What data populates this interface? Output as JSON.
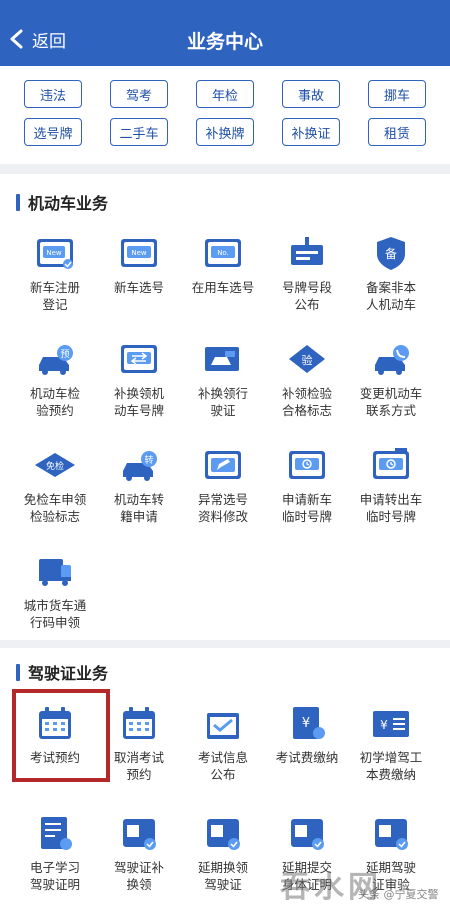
{
  "header": {
    "back_label": "返回",
    "title": "业务中心"
  },
  "chips": [
    "违法",
    "驾考",
    "年检",
    "事故",
    "挪车",
    "选号牌",
    "二手车",
    "补换牌",
    "补换证",
    "租赁"
  ],
  "section1": {
    "title": "机动车业务",
    "items": [
      {
        "label": "新车注册\n登记",
        "icon": "new-car-registration-icon"
      },
      {
        "label": "新车选号",
        "icon": "new-car-plate-icon"
      },
      {
        "label": "在用车选号",
        "icon": "in-use-plate-icon"
      },
      {
        "label": "号牌号段\n公布",
        "icon": "plate-range-sign-icon"
      },
      {
        "label": "备案非本\n人机动车",
        "icon": "filing-shield-icon"
      },
      {
        "label": "机动车检\n验预约",
        "icon": "car-inspection-icon"
      },
      {
        "label": "补换领机\n动车号牌",
        "icon": "plate-exchange-icon"
      },
      {
        "label": "补换领行\n驶证",
        "icon": "license-exchange-icon"
      },
      {
        "label": "补领检验\n合格标志",
        "icon": "inspection-badge-icon"
      },
      {
        "label": "变更机动车\n联系方式",
        "icon": "car-phone-icon"
      },
      {
        "label": "免检车申领\n检验标志",
        "icon": "exempt-badge-icon"
      },
      {
        "label": "机动车转\n籍申请",
        "icon": "car-transfer-icon"
      },
      {
        "label": "异常选号\n资料修改",
        "icon": "edit-card-icon"
      },
      {
        "label": "申请新车\n临时号牌",
        "icon": "temp-plate-clock-icon"
      },
      {
        "label": "申请转出车\n临时号牌",
        "icon": "temp-plate-out-icon"
      },
      {
        "label": "城市货车通\n行码申领",
        "icon": "truck-pass-icon"
      }
    ]
  },
  "section2": {
    "title": "驾驶证业务",
    "items": [
      {
        "label": "考试预约",
        "icon": "calendar-icon"
      },
      {
        "label": "取消考试\n预约",
        "icon": "calendar-cancel-icon"
      },
      {
        "label": "考试信息\n公布",
        "icon": "exam-info-icon"
      },
      {
        "label": "考试费缴纳",
        "icon": "exam-fee-icon"
      },
      {
        "label": "初学增驾工\n本费缴纳",
        "icon": "fee-card-icon"
      },
      {
        "label": "电子学习\n驾驶证明",
        "icon": "e-study-doc-icon"
      },
      {
        "label": "驾驶证补\n换领",
        "icon": "license-renew-icon"
      },
      {
        "label": "延期换领\n驾驶证",
        "icon": "license-delay-icon"
      },
      {
        "label": "延期提交\n身体证明",
        "icon": "health-cert-icon"
      },
      {
        "label": "延期驾驶\n证审验",
        "icon": "license-review-icon"
      }
    ]
  },
  "watermark": {
    "big": "吞水网",
    "small": "头条 @宁夏交警"
  },
  "colors": {
    "primary": "#2e63c0",
    "light": "#5b9bf2",
    "highlight": "#b5282a"
  }
}
